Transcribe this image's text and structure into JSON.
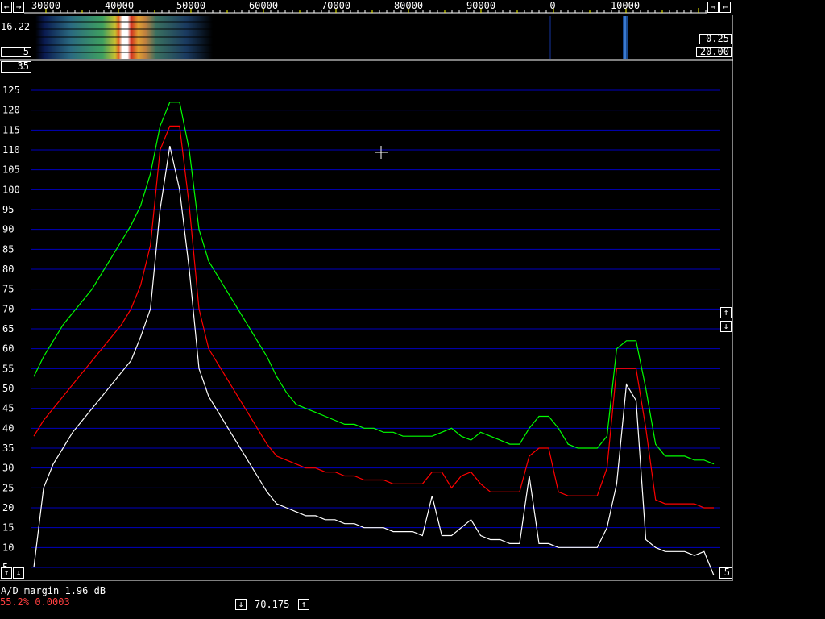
{
  "freq_axis": {
    "labels": [
      "30000",
      "40000",
      "50000",
      "60000",
      "70000",
      "80000",
      "90000",
      "0",
      "10000"
    ]
  },
  "waterfall": {
    "left_top_value": "16.22",
    "left_bottom_value": "5",
    "right_top_value": "0.25",
    "right_bottom_value": "20.00"
  },
  "spectrum_top_box": "35",
  "bottom_right_box": "5",
  "status": {
    "ad_margin": "A/D margin 1.96 dB",
    "cpu": "55.2% 0.0003"
  },
  "center_freq": "70.175",
  "icons": {
    "left_arrow": "arrow-left-icon",
    "right_arrow": "arrow-right-icon",
    "up_arrow": "arrow-up-icon",
    "down_arrow": "arrow-down-icon"
  },
  "colors": {
    "grid": "#0000c0",
    "green_trace": "#00ff00",
    "red_trace": "#ff0000",
    "white_trace": "#ffffff",
    "cpu_text": "#ff4040"
  },
  "chart_data": {
    "type": "line",
    "ylim": [
      0,
      125
    ],
    "y_ticks": [
      5,
      10,
      15,
      20,
      25,
      30,
      35,
      40,
      45,
      50,
      55,
      60,
      65,
      70,
      75,
      80,
      85,
      90,
      95,
      100,
      105,
      110,
      115,
      120,
      125
    ],
    "x_labels": [
      "30000",
      "40000",
      "50000",
      "60000",
      "70000",
      "80000",
      "90000",
      "0",
      "10000"
    ],
    "series": [
      {
        "values": [
          53,
          58,
          62,
          66,
          69,
          72,
          75,
          79,
          83,
          87,
          91,
          96,
          104,
          116,
          122,
          122,
          110,
          90,
          82,
          78,
          74,
          70,
          66,
          62,
          58,
          53,
          49,
          46,
          45,
          44,
          43,
          42,
          41,
          41,
          40,
          40,
          39,
          39,
          38,
          38,
          38,
          38,
          39,
          40,
          38,
          37,
          39,
          38,
          37,
          36,
          36,
          40,
          43,
          43,
          40,
          36,
          35,
          35,
          35,
          38,
          60,
          62,
          62,
          50,
          36,
          33,
          33,
          33,
          32,
          32,
          31
        ]
      },
      {
        "values": [
          38,
          42,
          45,
          48,
          51,
          54,
          57,
          60,
          63,
          66,
          70,
          76,
          86,
          110,
          116,
          116,
          96,
          70,
          60,
          56,
          52,
          48,
          44,
          40,
          36,
          33,
          32,
          31,
          30,
          30,
          29,
          29,
          28,
          28,
          27,
          27,
          27,
          26,
          26,
          26,
          26,
          29,
          29,
          25,
          28,
          29,
          26,
          24,
          24,
          24,
          24,
          33,
          35,
          35,
          24,
          23,
          23,
          23,
          23,
          30,
          55,
          55,
          55,
          40,
          22,
          21,
          21,
          21,
          21,
          20,
          20
        ]
      },
      {
        "values": [
          5,
          25,
          31,
          35,
          39,
          42,
          45,
          48,
          51,
          54,
          57,
          63,
          70,
          95,
          111,
          100,
          80,
          55,
          48,
          44,
          40,
          36,
          32,
          28,
          24,
          21,
          20,
          19,
          18,
          18,
          17,
          17,
          16,
          16,
          15,
          15,
          15,
          14,
          14,
          14,
          13,
          23,
          13,
          13,
          15,
          17,
          13,
          12,
          12,
          11,
          11,
          28,
          11,
          11,
          10,
          10,
          10,
          10,
          10,
          15,
          26,
          51,
          47,
          12,
          10,
          9,
          9,
          9,
          8,
          9,
          3
        ]
      }
    ]
  }
}
